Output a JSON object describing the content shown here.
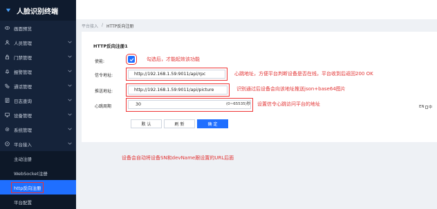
{
  "sidebar": {
    "brand": "人脸识别终端",
    "items": [
      {
        "label": "画面预览",
        "icon": "eye-icon"
      },
      {
        "label": "人员管理",
        "icon": "user-icon",
        "chevron": true
      },
      {
        "label": "门禁管理",
        "icon": "lock-icon",
        "chevron": true
      },
      {
        "label": "报警管理",
        "icon": "bell-icon",
        "chevron": true
      },
      {
        "label": "通话管理",
        "icon": "phone-icon",
        "chevron": true
      },
      {
        "label": "日志查询",
        "icon": "log-icon",
        "chevron": true
      },
      {
        "label": "设备管理",
        "icon": "device-icon",
        "chevron": true
      },
      {
        "label": "系统管理",
        "icon": "gear-icon",
        "chevron": true
      },
      {
        "label": "平台接入",
        "icon": "platform-icon",
        "chevron": true
      }
    ],
    "subitems": [
      {
        "label": "主动注册"
      },
      {
        "label": "WebSocket注册"
      },
      {
        "label": "http反向注册",
        "active": true
      },
      {
        "label": "平台配置"
      }
    ]
  },
  "breadcrumb": {
    "parent": "平台接入",
    "sep": "/",
    "current": "HTTP反向注册"
  },
  "form": {
    "title": "HTTP反向注册1",
    "enable_label": "使能:",
    "heartbeat_addr_label": "信令地址:",
    "heartbeat_addr_value": "http://192.168.1.59:9011/api/rpc",
    "push_addr_label": "推送地址:",
    "push_addr_value": "http://192.168.1.59:9011/api/picture",
    "period_label": "心跳周期",
    "period_value": "30",
    "period_unit": "(0~65535)秒",
    "buttons": {
      "default": "默 认",
      "refresh": "刷 新",
      "confirm": "确 定"
    }
  },
  "notes": {
    "enable": "勾选后，才能起效该功能",
    "heartbeat": "心跳地址，方便平台判断设备是否在线，平台收到后返回200 OK",
    "push": "识别通过后设备会向该地址推送json+base64图片",
    "period": "设置信令心跳访问平台的地址",
    "bottom": "设备会自动将设备SN和devName跟设置的URL后面"
  },
  "lang": {
    "en": "EN",
    "zh": "中"
  },
  "colors": {
    "sidebar": "#15233a",
    "accent": "#1f6fff",
    "annotation": "#e23232"
  }
}
